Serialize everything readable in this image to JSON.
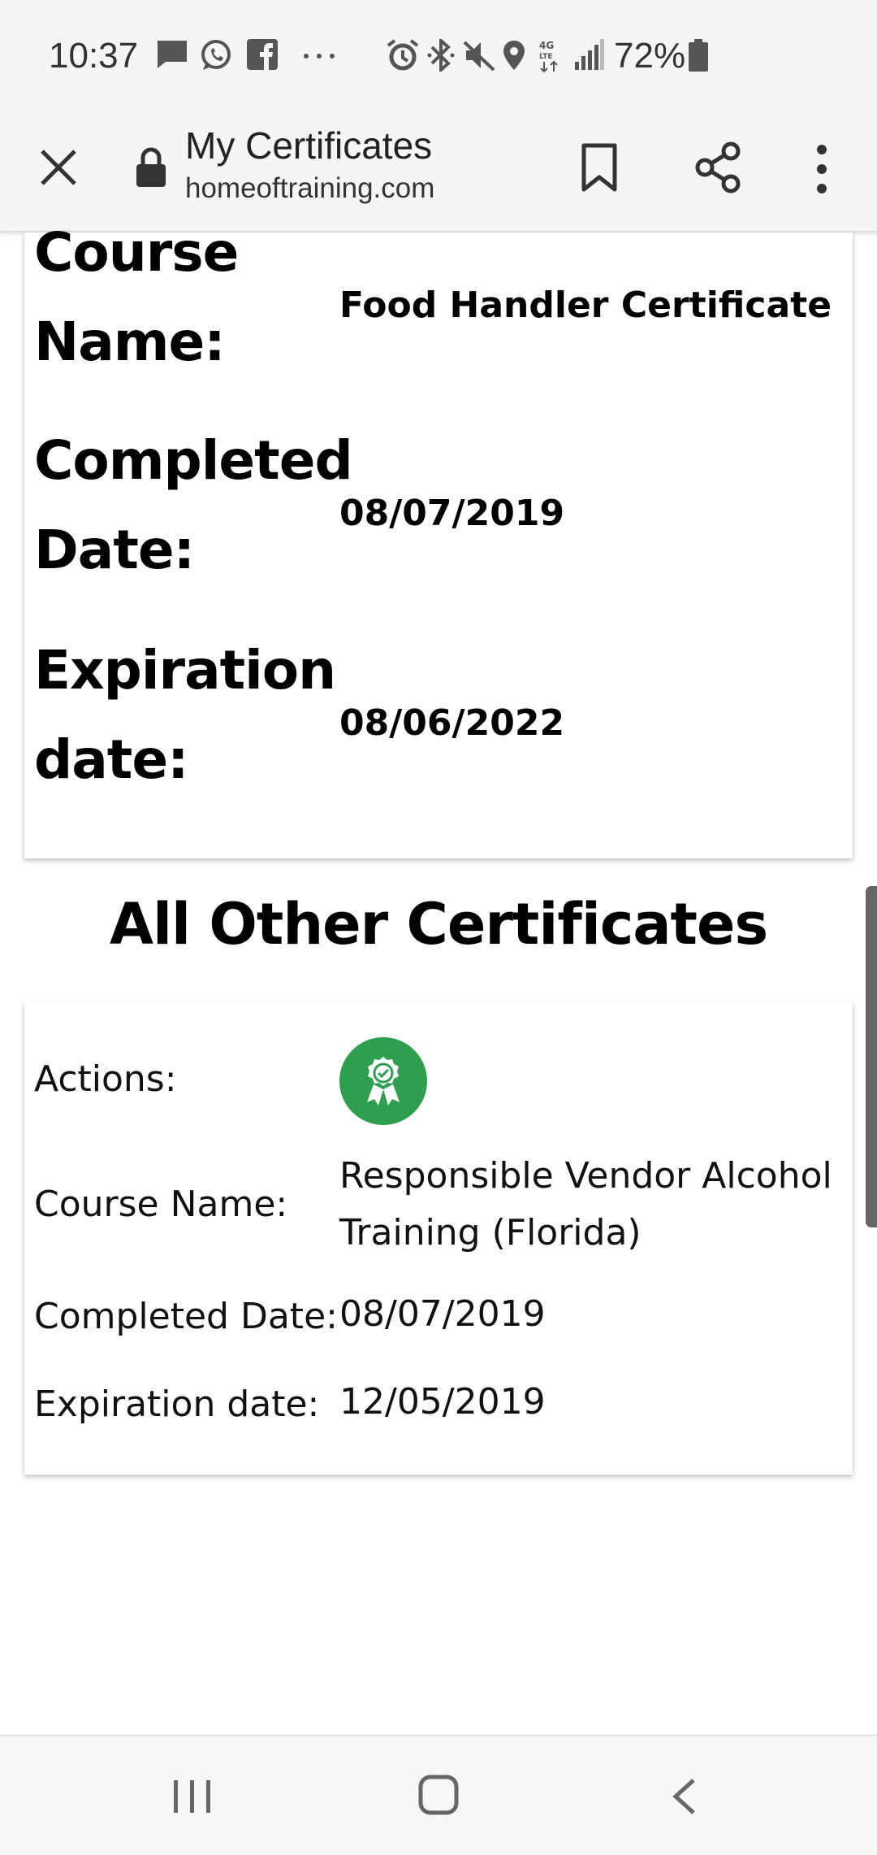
{
  "status_bar": {
    "time": "10:37",
    "battery": "72%",
    "icons": [
      "message-icon",
      "whatsapp-icon",
      "facebook-icon",
      "more-notifications-icon",
      "alarm-icon",
      "bluetooth-icon",
      "mute-icon",
      "location-icon",
      "4g-lte-icon",
      "signal-icon",
      "battery-icon"
    ]
  },
  "toolbar": {
    "title": "My Certificates",
    "url": "homeoftraining.com"
  },
  "current_certificate": {
    "course_name_label": "Course Name:",
    "course_name": "Food Handler Certificate",
    "completed_label": "Completed Date:",
    "completed_date": "08/07/2019",
    "expiration_label": "Expiration date:",
    "expiration_date": "08/06/2022"
  },
  "other_section": {
    "title": "All Other Certificates"
  },
  "other_certificates": [
    {
      "actions_label": "Actions:",
      "course_name_label": "Course Name:",
      "course_name": "Responsible Vendor Alcohol Training (Florida)",
      "completed_label": "Completed Date:",
      "completed_date": "08/07/2019",
      "expiration_label": "Expiration date:",
      "expiration_date": "12/05/2019"
    }
  ],
  "colors": {
    "action_button": "#2e9e4f",
    "bar_background": "#f5f5f5"
  }
}
